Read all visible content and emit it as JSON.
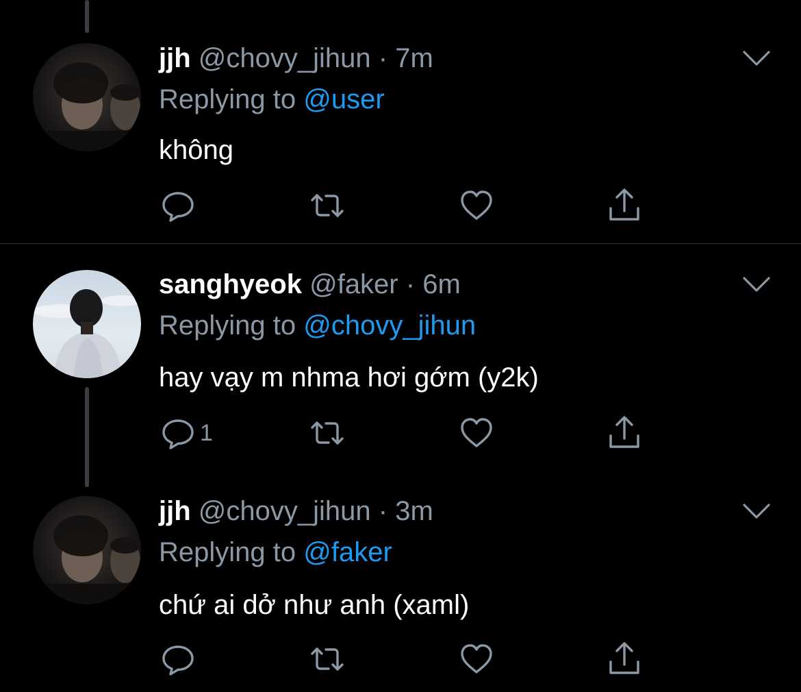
{
  "colors": {
    "background": "#000000",
    "text": "#ffffff",
    "muted": "#8b98a5",
    "accent": "#1d9bf0",
    "divider": "#2f3336"
  },
  "tweets": [
    {
      "display_name": "jjh",
      "handle": "@chovy_jihun",
      "separator": "·",
      "time": "7m",
      "reply_prefix": "Replying to",
      "reply_to": "@user",
      "text": "không",
      "reply_count": "",
      "icons": [
        "reply-icon",
        "retweet-icon",
        "like-icon",
        "share-icon",
        "chevron-down-icon"
      ]
    },
    {
      "display_name": "sanghyeok",
      "handle": "@faker",
      "separator": "·",
      "time": "6m",
      "reply_prefix": "Replying to",
      "reply_to": "@chovy_jihun",
      "text": "hay vạy m nhma hơi gớm (y2k)",
      "reply_count": "1",
      "icons": [
        "reply-icon",
        "retweet-icon",
        "like-icon",
        "share-icon",
        "chevron-down-icon"
      ]
    },
    {
      "display_name": "jjh",
      "handle": "@chovy_jihun",
      "separator": "·",
      "time": "3m",
      "reply_prefix": "Replying to",
      "reply_to": "@faker",
      "text": "chứ ai dở như anh (xaml)",
      "reply_count": "",
      "icons": [
        "reply-icon",
        "retweet-icon",
        "like-icon",
        "share-icon",
        "chevron-down-icon"
      ]
    }
  ]
}
